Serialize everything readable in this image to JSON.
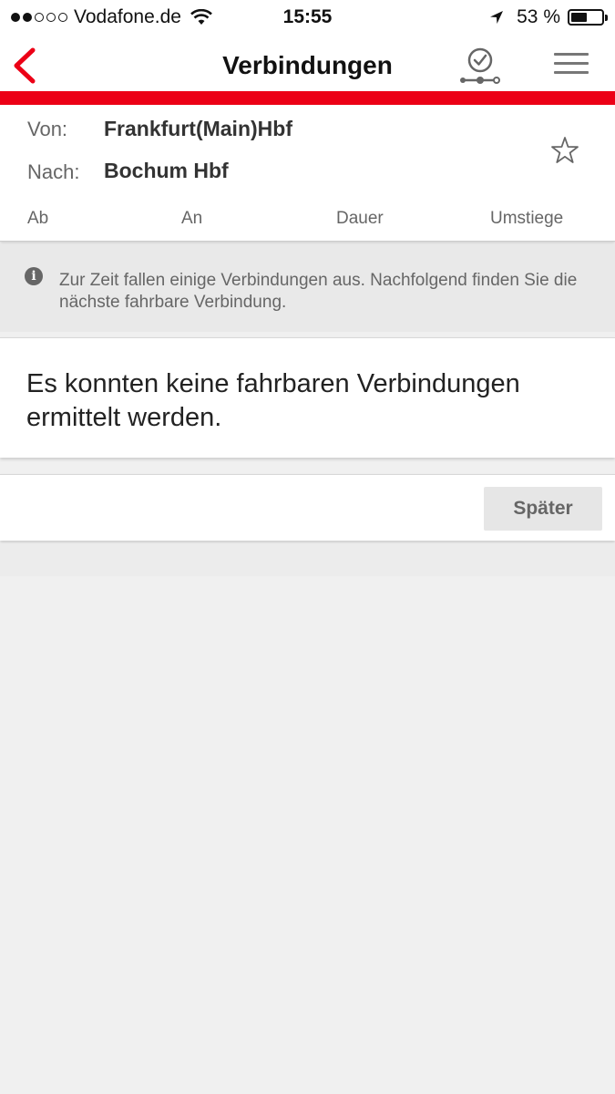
{
  "status_bar": {
    "carrier": "Vodafone.de",
    "time": "15:55",
    "battery": "53 %",
    "battery_level": 0.53,
    "signal_bars_filled": 2,
    "signal_bars_total": 5
  },
  "nav": {
    "title": "Verbindungen",
    "icons": [
      "back-chevron-icon",
      "clock-check-icon",
      "hamburger-menu-icon"
    ],
    "accent_color": "#ec0016"
  },
  "route": {
    "from_label": "Von:",
    "from_value": "Frankfurt(Main)Hbf",
    "to_label": "Nach:",
    "to_value": "Bochum Hbf",
    "favorite_icon": "star-outline-icon",
    "columns": [
      "Ab",
      "An",
      "Dauer",
      "Umstiege"
    ]
  },
  "info": {
    "icon": "info-icon",
    "text": "Zur Zeit fallen einige Verbindungen aus. Nachfolgend finden Sie die nächste fahrbare Verbindung."
  },
  "result": {
    "message": "Es konnten keine fahrbaren Verbindungen ermittelt werden."
  },
  "actions": {
    "later_label": "Später"
  }
}
